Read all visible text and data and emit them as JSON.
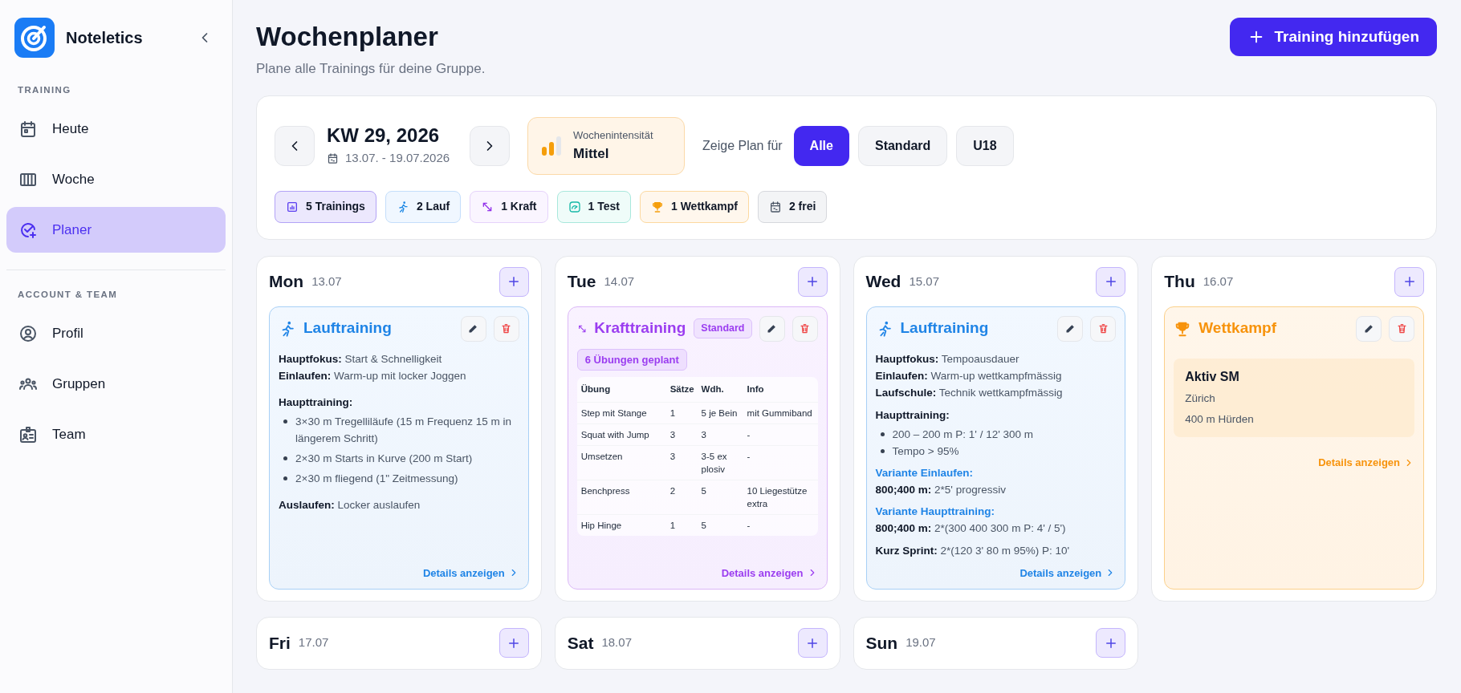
{
  "sidebar": {
    "brand": "Noteletics",
    "sections": [
      {
        "title": "TRAINING",
        "items": [
          {
            "label": "Heute",
            "selected": false
          },
          {
            "label": "Woche",
            "selected": false
          },
          {
            "label": "Planer",
            "selected": true
          }
        ]
      },
      {
        "title": "ACCOUNT & TEAM",
        "items": [
          {
            "label": "Profil",
            "selected": false
          },
          {
            "label": "Gruppen",
            "selected": false
          },
          {
            "label": "Team",
            "selected": false
          }
        ]
      }
    ]
  },
  "header": {
    "title": "Wochenplaner",
    "subtitle": "Plane alle Trainings für deine Gruppe.",
    "add_button": "Training hinzufügen"
  },
  "week": {
    "label": "KW 29, 2026",
    "range": "13.07. - 19.07.2026",
    "intensity": {
      "label": "Wochenintensität",
      "value": "Mittel"
    },
    "filter_label": "Zeige Plan für",
    "filters": [
      {
        "label": "Alle",
        "selected": true
      },
      {
        "label": "Standard",
        "selected": false
      },
      {
        "label": "U18",
        "selected": false
      }
    ],
    "stats": [
      {
        "kind": "total",
        "label": "5 Trainings"
      },
      {
        "kind": "lauf",
        "label": "2 Lauf"
      },
      {
        "kind": "kraft",
        "label": "1 Kraft"
      },
      {
        "kind": "test",
        "label": "1 Test"
      },
      {
        "kind": "wettkampf",
        "label": "1 Wettkampf"
      },
      {
        "kind": "frei",
        "label": "2 frei"
      }
    ]
  },
  "days": [
    {
      "name": "Mon",
      "date": "13.07",
      "trainings": [
        {
          "kind": "lauf",
          "title": "Lauftraining",
          "details": "Details anzeigen",
          "blocks": [
            {
              "kind": "lines",
              "lines": [
                "**Hauptfokus:** Start & Schnelligkeit",
                "**Einlaufen:** Warm-up mit locker Joggen"
              ]
            },
            {
              "kind": "list",
              "heading": "Haupttraining:",
              "items": [
                "3×30 m Tregelliläufe (15 m Frequenz 15 m in längerem Schritt)",
                "2×30 m Starts in Kurve (200 m Start)",
                "2×30 m fliegend (1\" Zeitmessung)"
              ]
            },
            {
              "kind": "lines",
              "lines": [
                "**Auslaufen:** Locker auslaufen"
              ]
            }
          ]
        }
      ]
    },
    {
      "name": "Tue",
      "date": "14.07",
      "trainings": [
        {
          "kind": "kraft",
          "title": "Krafttraining",
          "badge": "Standard",
          "count": "6 Übungen geplant",
          "details": "Details anzeigen",
          "table": {
            "columns": [
              "Übung",
              "Sätze",
              "Wdh.",
              "Info"
            ],
            "rows": [
              [
                "Step mit Stange",
                "1",
                "5 je Bein",
                "mit Gummiband"
              ],
              [
                "Squat with Jump",
                "3",
                "3",
                "-"
              ],
              [
                "Umsetzen",
                "3",
                "3-5 ex plosiv",
                "-"
              ],
              [
                "Benchpress",
                "2",
                "5",
                "10 Liegestütze extra"
              ],
              [
                "Hip Hinge",
                "1",
                "5",
                "-"
              ]
            ]
          }
        }
      ]
    },
    {
      "name": "Wed",
      "date": "15.07",
      "trainings": [
        {
          "kind": "lauf",
          "title": "Lauftraining",
          "details": "Details anzeigen",
          "blocks": [
            {
              "kind": "lines",
              "lines": [
                "**Hauptfokus:** Tempoausdauer",
                "**Einlaufen:** Warm-up wettkampfmässig",
                "**Laufschule:** Technik wettkampfmässig"
              ]
            },
            {
              "kind": "list",
              "heading": "Haupttraining:",
              "items": [
                "200 – 200 m P: 1' / 12' 300 m",
                "Tempo > 95%"
              ]
            },
            {
              "kind": "variant",
              "heading": "Variante Einlaufen:",
              "lines": [
                "**800;400 m:** 2*5' progressiv"
              ]
            },
            {
              "kind": "variant",
              "heading": "Variante Haupttraining:",
              "lines": [
                "**800;400 m:** 2*(300 400 300 m P: 4' / 5')"
              ]
            },
            {
              "kind": "lines",
              "lines": [
                "**Kurz Sprint:** 2*(120 3' 80 m 95%) P: 10'"
              ]
            }
          ]
        }
      ]
    },
    {
      "name": "Thu",
      "date": "16.07",
      "trainings": [
        {
          "kind": "wettkampf",
          "title": "Wettkampf",
          "details": "Details anzeigen",
          "event": {
            "name": "Aktiv SM",
            "place": "Zürich",
            "discipline": "400 m Hürden"
          }
        }
      ]
    },
    {
      "name": "Fri",
      "date": "17.07"
    },
    {
      "name": "Sat",
      "date": "18.07"
    },
    {
      "name": "Sun",
      "date": "19.07"
    }
  ]
}
